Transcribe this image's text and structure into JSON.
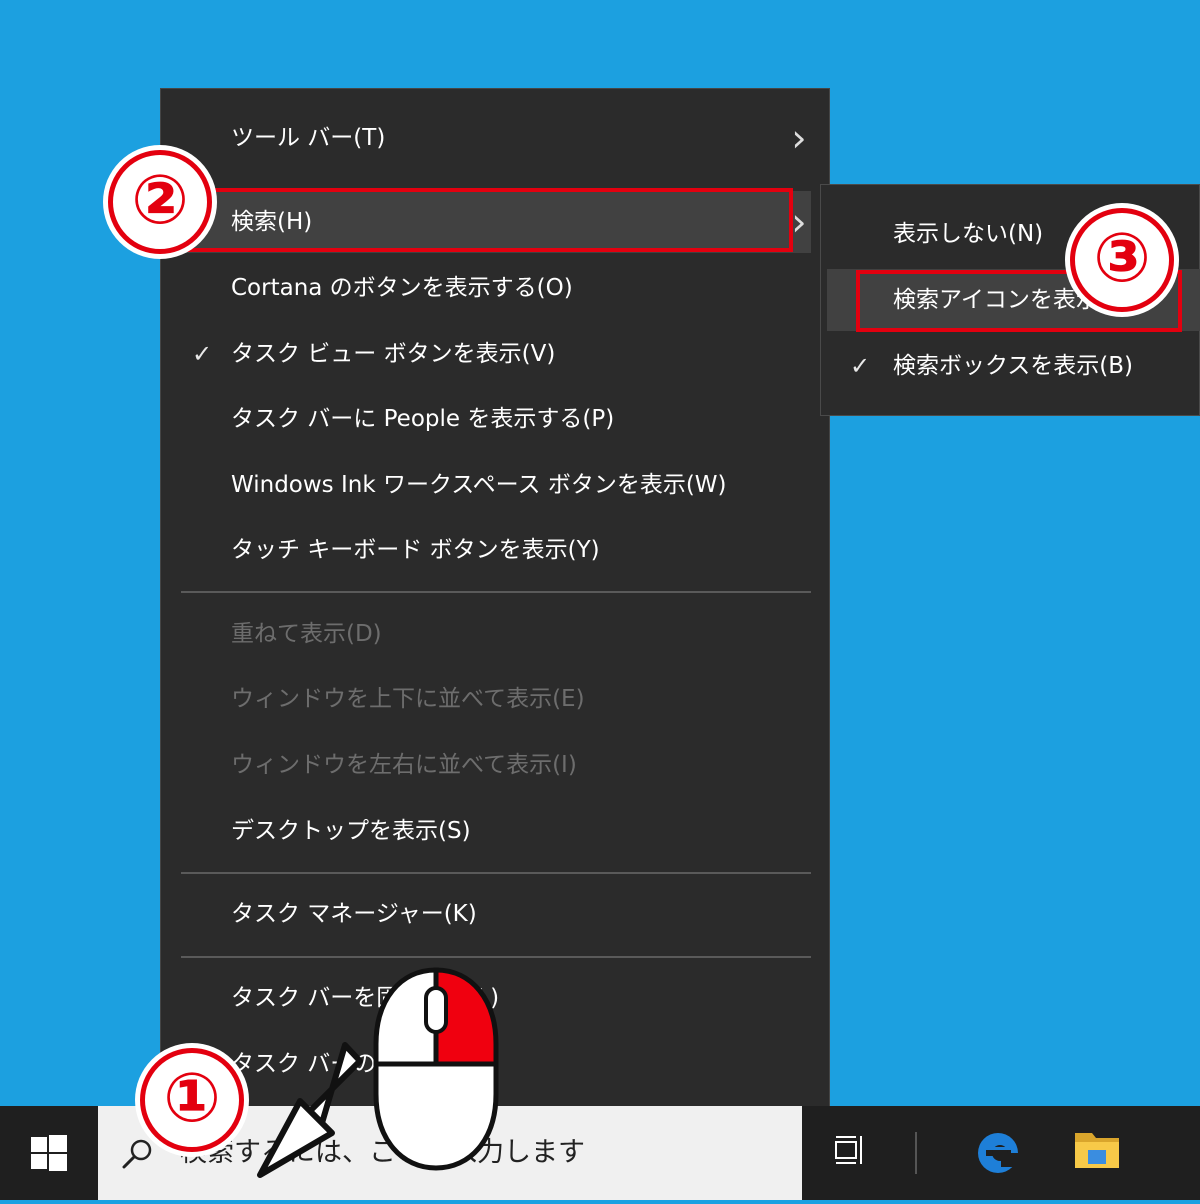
{
  "menu": {
    "items": [
      {
        "label": "ツール バー(T)",
        "arrow": "›"
      },
      {
        "label": "検索(H)",
        "arrow": "›"
      },
      {
        "label": "Cortana のボタンを表示する(O)"
      },
      {
        "label": "タスク ビュー ボタンを表示(V)",
        "check": "✓"
      },
      {
        "label": "タスク バーに People を表示する(P)"
      },
      {
        "label": "Windows Ink ワークスペース ボタンを表示(W)"
      },
      {
        "label": "タッチ キーボード ボタンを表示(Y)"
      },
      {
        "label": "重ねて表示(D)"
      },
      {
        "label": "ウィンドウを上下に並べて表示(E)"
      },
      {
        "label": "ウィンドウを左右に並べて表示(I)"
      },
      {
        "label": "デスクトップを表示(S)"
      },
      {
        "label": "タスク マネージャー(K)"
      },
      {
        "label": "タスク バーを固定する(L)"
      },
      {
        "label": "タスク バーの設定(T)",
        "check": "⚙"
      }
    ]
  },
  "submenu": {
    "items": [
      {
        "label": "表示しない(N)"
      },
      {
        "label": "検索アイコンを表示(C)"
      },
      {
        "label": "検索ボックスを表示(B)",
        "check": "✓"
      }
    ]
  },
  "annotations": {
    "step1": "①",
    "step2": "②",
    "step3": "③"
  },
  "taskbar": {
    "search_placeholder": "検索するには、ここに入力します",
    "icons": [
      "windows-start-icon",
      "search-icon",
      "task-view-icon",
      "edge-icon",
      "file-explorer-icon"
    ]
  },
  "colors": {
    "desktop": "#1ca0e0",
    "menu_bg": "#2b2b2b",
    "highlight": "#e3000f",
    "taskbar": "#1f1f1f",
    "edge_blue": "#1e7fd8",
    "folder_yellow": "#f7c948"
  }
}
